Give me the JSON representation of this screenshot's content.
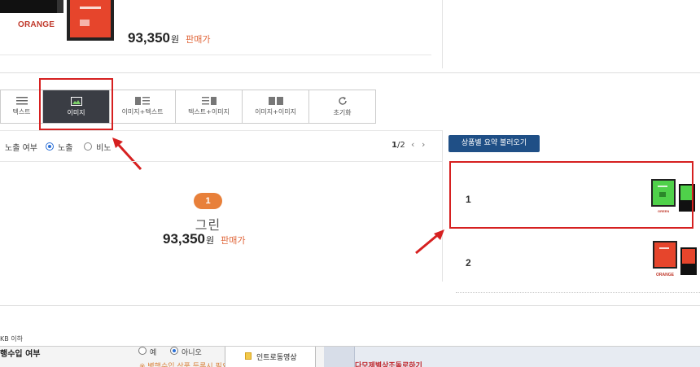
{
  "top": {
    "brand": "ORANGE",
    "price": "93,350",
    "won": "원",
    "sale_label": "판매가"
  },
  "view_modes": [
    {
      "label": "텍스트",
      "icon": "text-lines-icon",
      "active": false
    },
    {
      "label": "이미지",
      "icon": "image-icon",
      "active": true
    },
    {
      "label": "이미지+텍스트",
      "icon": "image-text-icon",
      "active": false
    },
    {
      "label": "텍스트+이미지",
      "icon": "text-image-icon",
      "active": false
    },
    {
      "label": "이미지+이미지",
      "icon": "image-image-icon",
      "active": false
    },
    {
      "label": "초기화",
      "icon": "reset-icon",
      "active": false
    }
  ],
  "exposure": {
    "label": "노출 여부",
    "options": [
      {
        "label": "노출",
        "selected": true
      },
      {
        "label": "비노",
        "selected": false
      }
    ]
  },
  "pager": {
    "current": "1",
    "total": "/2"
  },
  "preview": {
    "number": "1",
    "name": "그린",
    "price": "93,350",
    "won": "원",
    "sale_label": "판매가"
  },
  "right_panel": {
    "load_button": "상품별 요약 불러오기",
    "items": [
      {
        "num": "1",
        "color": "green",
        "brand": "GREEN"
      },
      {
        "num": "2",
        "color": "orange",
        "brand": "ORANGE"
      }
    ]
  },
  "size_note": "KB 이하",
  "background_window": {
    "label": "행수입 여부",
    "option_yes": "예",
    "option_no": "아니오",
    "warning": "※ 병행수입 상품 등록시 필요",
    "file_item": "인트로동영상",
    "red_title": "다모제별상조돌로하기"
  },
  "colors": {
    "active_tab": "#3a3d44",
    "accent_orange": "#e8803a",
    "button_blue": "#1f4f86",
    "highlight_red": "#d62020",
    "radio_blue": "#2a6fd6"
  }
}
